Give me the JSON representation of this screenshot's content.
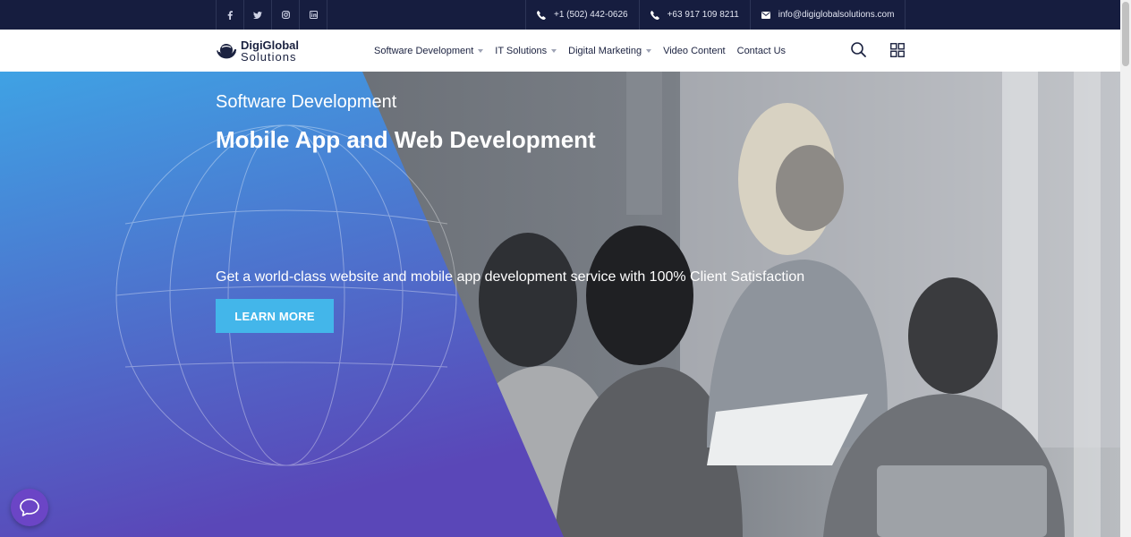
{
  "topbar": {
    "social": [
      {
        "name": "facebook-icon",
        "glyph": "f"
      },
      {
        "name": "twitter-icon",
        "glyph": "t"
      },
      {
        "name": "instagram-icon",
        "glyph": "ig"
      },
      {
        "name": "linkedin-icon",
        "glyph": "in"
      }
    ],
    "phone1": "+1 (502) 442-0626",
    "phone2": "+63 917 109 8211",
    "email": "info@digiglobalsolutions.com"
  },
  "logo": {
    "top": "DigiGlobal",
    "bottom": "Solutions"
  },
  "nav": {
    "items": [
      {
        "label": "Software Development",
        "dropdown": true
      },
      {
        "label": "IT Solutions",
        "dropdown": true
      },
      {
        "label": "Digital Marketing",
        "dropdown": true
      },
      {
        "label": "Video Content",
        "dropdown": false
      },
      {
        "label": "Contact Us",
        "dropdown": false
      }
    ]
  },
  "hero": {
    "kicker": "Software Development",
    "headline": "Mobile App and Web Development",
    "tagline": "Get a world-class website and mobile app development service with 100% Client Satisfaction",
    "cta": "LEARN MORE"
  },
  "colors": {
    "topbar": "#161d3f",
    "accent": "#43b6ea",
    "gradient_top": "#3fa2e4",
    "gradient_bottom": "#5a47b8",
    "chat": "#6b45c6"
  }
}
